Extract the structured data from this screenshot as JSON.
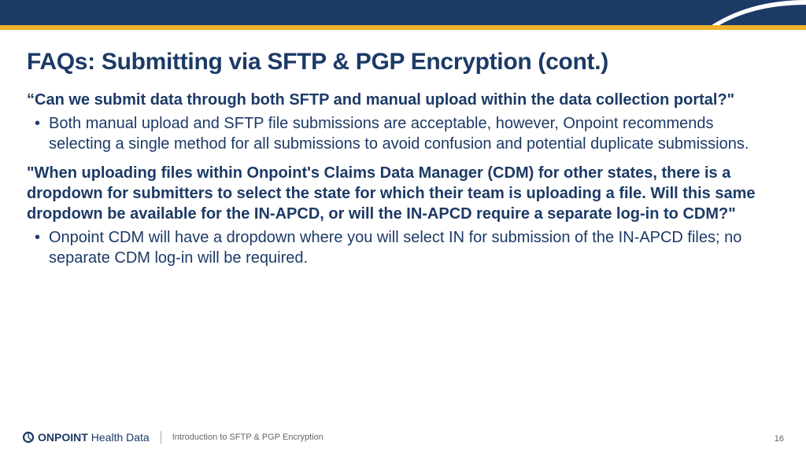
{
  "slide": {
    "title": "FAQs: Submitting via SFTP & PGP Encryption (cont.)",
    "q1": "“Can we submit data through both SFTP and manual upload within the data collection portal?\"",
    "a1": "Both manual upload and SFTP file submissions are acceptable, however, Onpoint recommends selecting a single method for all submissions to avoid confusion and potential duplicate submissions.",
    "q2": "\"When uploading files within Onpoint's Claims Data Manager (CDM) for other states, there is a dropdown for submitters to select the state for which their team is uploading a file. Will this same dropdown be available for the IN-APCD, or will the IN-APCD require a separate log-in to CDM?\"",
    "a2": "Onpoint CDM will have a dropdown where you will select IN for submission of the IN-APCD files; no separate CDM log-in will be required."
  },
  "footer": {
    "brand_bold": "ONPOINT",
    "brand_light": "Health Data",
    "doc_title": "Introduction to SFTP & PGP Encryption",
    "page": "16"
  }
}
